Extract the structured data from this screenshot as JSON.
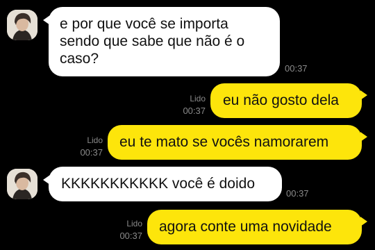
{
  "chat": {
    "messages": [
      {
        "direction": "incoming",
        "text": "e por que você se importa\nsendo que sabe que não é o\ncaso?",
        "time": "00:37",
        "read": ""
      },
      {
        "direction": "outgoing",
        "text": "eu não gosto dela",
        "time": "00:37",
        "read": "Lido"
      },
      {
        "direction": "outgoing",
        "text": "eu te mato se vocês namorarem",
        "time": "00:37",
        "read": "Lido"
      },
      {
        "direction": "incoming",
        "text": "KKKKKKKKKKK você é doido",
        "time": "00:37",
        "read": ""
      },
      {
        "direction": "outgoing",
        "text": "agora conte uma novidade",
        "time": "00:37",
        "read": "Lido"
      }
    ]
  },
  "colors": {
    "background": "#000000",
    "incoming_bubble": "#ffffff",
    "outgoing_bubble": "#fde50b",
    "meta_text": "#8a8a8a"
  },
  "icons": {
    "avatar": "profile-photo-icon"
  }
}
